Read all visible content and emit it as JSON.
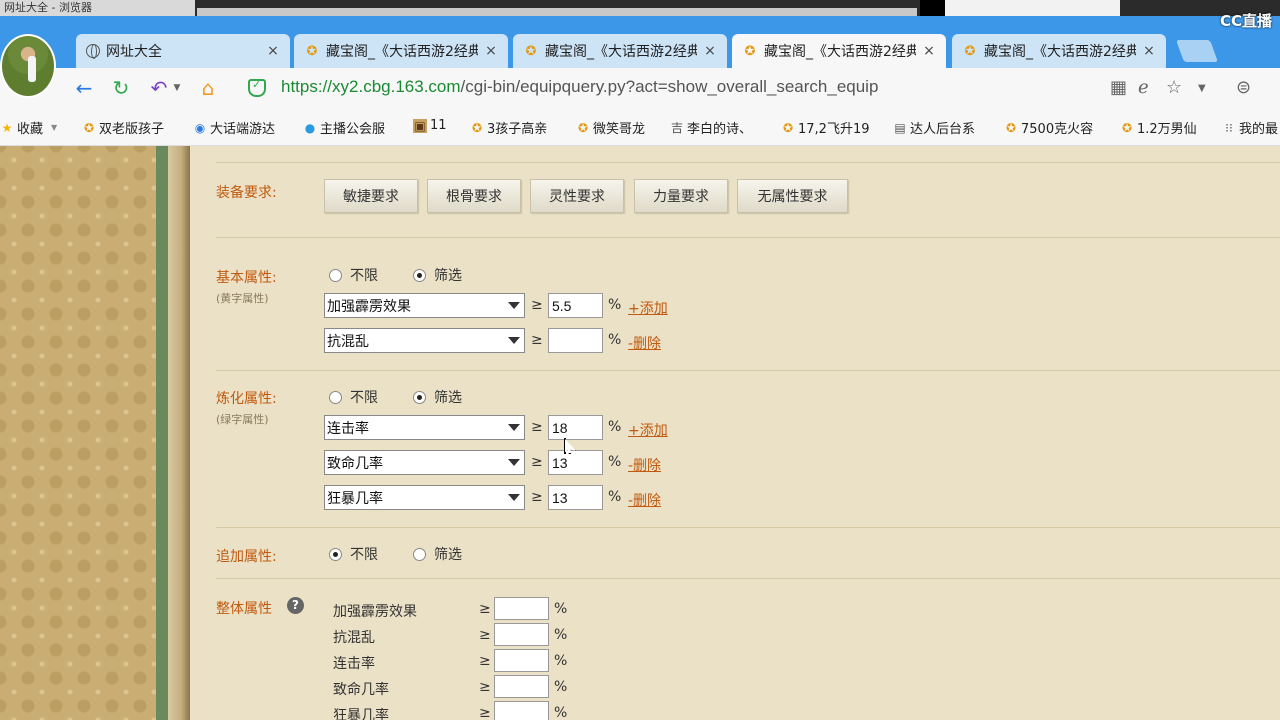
{
  "os": {
    "left_title": "网址大全 - 浏览器",
    "cc_logo": "CC直播"
  },
  "tabs": [
    {
      "label": "网址大全",
      "icon": "globe-icon",
      "close": "×"
    },
    {
      "label": "藏宝阁_《大话西游2经典",
      "icon": "treasure-icon",
      "close": "×"
    },
    {
      "label": "藏宝阁_《大话西游2经典",
      "icon": "treasure-icon",
      "close": "×"
    },
    {
      "label": "藏宝阁_《大话西游2经典",
      "icon": "treasure-icon",
      "close": "×",
      "active": true
    },
    {
      "label": "藏宝阁_《大话西游2经典",
      "icon": "treasure-icon",
      "close": "×"
    }
  ],
  "address": {
    "scheme": "https://",
    "host": "xy2.cbg.163.com",
    "path": "/cgi-bin/equipquery.py?act=show_overall_search_equip"
  },
  "bookmarks": [
    {
      "label": "收藏",
      "icon": "star-icon"
    },
    {
      "label": "双老版孩子",
      "icon": "treasure-icon"
    },
    {
      "label": "大话端游达",
      "icon": "game-icon"
    },
    {
      "label": "主播公会服",
      "icon": "user-icon"
    },
    {
      "label": "11",
      "icon": "image-icon"
    },
    {
      "label": "3孩子高亲",
      "icon": "treasure-icon"
    },
    {
      "label": "微笑哥龙",
      "icon": "treasure-icon"
    },
    {
      "label": "李白的诗、",
      "icon": "tree-icon"
    },
    {
      "label": "17,2飞升19",
      "icon": "treasure-icon"
    },
    {
      "label": "达人后台系",
      "icon": "document-icon"
    },
    {
      "label": "7500克火容",
      "icon": "treasure-icon"
    },
    {
      "label": "1.2万男仙",
      "icon": "treasure-icon"
    },
    {
      "label": "我的最",
      "icon": "apps-icon"
    }
  ],
  "equip_req": {
    "label": "装备要求:",
    "buttons": [
      "敏捷要求",
      "根骨要求",
      "灵性要求",
      "力量要求",
      "无属性要求"
    ]
  },
  "basic": {
    "label": "基本属性:",
    "sub": "(黄字属性)",
    "radio_unlimited": "不限",
    "radio_filter": "筛选",
    "rows": [
      {
        "select": "加强霹雳效果",
        "value": "5.5",
        "link": "+添加"
      },
      {
        "select": "抗混乱",
        "value": "",
        "link": "-删除"
      }
    ]
  },
  "refine": {
    "label": "炼化属性:",
    "sub": "(绿字属性)",
    "radio_unlimited": "不限",
    "radio_filter": "筛选",
    "rows": [
      {
        "select": "连击率",
        "value": "18",
        "link": "+添加"
      },
      {
        "select": "致命几率",
        "value": "13",
        "link": "-删除"
      },
      {
        "select": "狂暴几率",
        "value": "13",
        "link": "-删除"
      }
    ]
  },
  "extra": {
    "label": "追加属性:",
    "radio_unlimited": "不限",
    "radio_filter": "筛选"
  },
  "overall": {
    "label": "整体属性",
    "help": "?",
    "rows": [
      "加强霹雳效果",
      "抗混乱",
      "连击率",
      "致命几率",
      "狂暴几率"
    ]
  },
  "symbols": {
    "ge": "≥",
    "pct": "%"
  }
}
